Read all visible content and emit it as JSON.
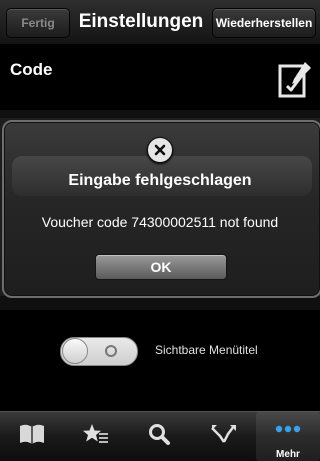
{
  "navbar": {
    "done_label": "Fertig",
    "title": "Einstellungen",
    "restore_label": "Wiederherstellen"
  },
  "content": {
    "code_label": "Code",
    "edit_icon": "edit-note-icon"
  },
  "alert": {
    "close_icon": "close-circle-icon",
    "title": "Eingabe fehlgeschlagen",
    "message": "Voucher code 74300002511 not found",
    "ok_label": "OK"
  },
  "toggle": {
    "label": "Sichtbare Menütitel",
    "state": "off"
  },
  "tabbar": {
    "tabs": [
      {
        "icon": "book-icon",
        "label": ""
      },
      {
        "icon": "star-list-icon",
        "label": ""
      },
      {
        "icon": "search-icon",
        "label": ""
      },
      {
        "icon": "shuffle-arrows-icon",
        "label": ""
      },
      {
        "icon": "more-dots-icon",
        "label": "Mehr",
        "active": true
      }
    ]
  },
  "colors": {
    "background": "#000000",
    "more_dots": "#3ba0e6"
  }
}
